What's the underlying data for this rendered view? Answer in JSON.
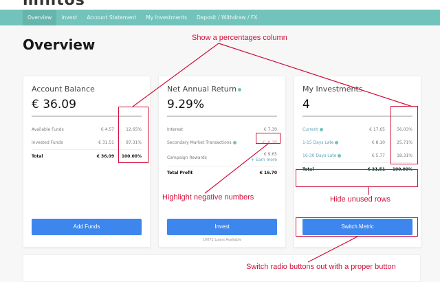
{
  "logo": "mintos",
  "nav": [
    "Overview",
    "Invest",
    "Account Statement",
    "My Investments",
    "Deposit / Withdraw / FX"
  ],
  "page_title": "Overview",
  "balance": {
    "title": "Account Balance",
    "value": "€ 36.09",
    "rows": [
      {
        "label": "Available Funds",
        "value": "€ 4.57",
        "pct": "12.65%"
      },
      {
        "label": "Invested Funds",
        "value": "€ 31.51",
        "pct": "87.31%"
      }
    ],
    "total": {
      "label": "Total",
      "value": "€ 36.09",
      "pct": "100.00%"
    },
    "button": "Add Funds"
  },
  "return": {
    "title": "Net Annual Return",
    "value": "9.29%",
    "rows": [
      {
        "label": "Interest",
        "value": "€ 7.30"
      },
      {
        "label": "Secondary Market Transactions",
        "value": "€ -0.20"
      },
      {
        "label": "Campaign Rewards",
        "value": "€ 9.65",
        "extra": "+ Earn more"
      }
    ],
    "total": {
      "label": "Total Profit",
      "value": "€ 16.70"
    },
    "button": "Invest",
    "sub": "19071 Loans Available"
  },
  "investments": {
    "title": "My Investments",
    "value": "4",
    "rows": [
      {
        "label": "Current",
        "value": "€ 17.65",
        "pct": "56.03%"
      },
      {
        "label": "1-15 Days Late",
        "value": "€ 8.10",
        "pct": "25.71%"
      },
      {
        "label": "16-30 Days Late",
        "value": "€ 5.77",
        "pct": "18.31%"
      }
    ],
    "total": {
      "label": "Total",
      "value": "€ 31.51",
      "pct": "100.00%"
    },
    "button": "Switch Metric"
  },
  "annotations": {
    "pct": "Show a percentages column",
    "neg": "Highlight negative numbers",
    "hide": "Hide unused rows",
    "switch": "Switch radio buttons out with a proper button"
  },
  "colors": {
    "nav": "#72c3bb",
    "button": "#3d86ee",
    "annotation": "#d0103a"
  }
}
